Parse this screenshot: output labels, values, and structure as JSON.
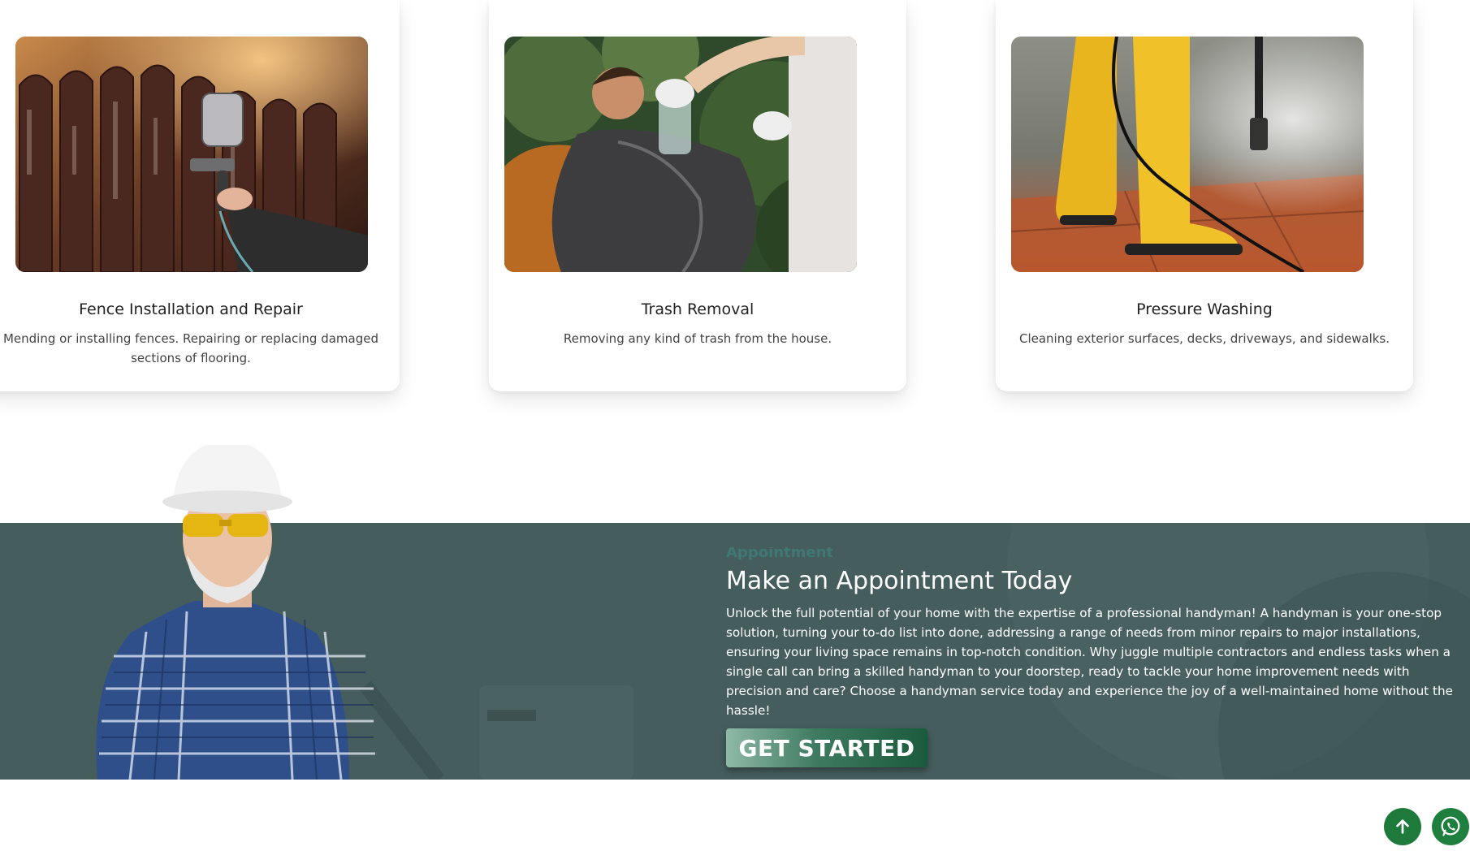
{
  "services": [
    {
      "title": "Fence Installation and Repair",
      "description": "Mending or installing fences. Repairing or replacing damaged sections of flooring.",
      "image_icon": "fence-spray-photo"
    },
    {
      "title": "Trash Removal",
      "description": "Removing any kind of trash from the house.",
      "image_icon": "trash-bag-photo"
    },
    {
      "title": "Pressure Washing",
      "description": "Cleaning exterior surfaces, decks, driveways, and sidewalks.",
      "image_icon": "pressure-washer-photo"
    }
  ],
  "appointment": {
    "eyebrow": "Appointment",
    "title": "Make an Appointment Today",
    "body": "Unlock the full potential of your home with the expertise of a professional handyman! A handyman is your one-stop solution, turning your to-do list into done, addressing a range of needs from minor repairs to major installations, ensuring your living space remains in top-notch condition. Why juggle multiple contractors and endless tasks when a single call can bring a skilled handyman to your doorstep, ready to tackle your home improvement needs with precision and care? Choose a handyman service today and experience the joy of a well-maintained home without the hassle!",
    "cta_label": "GET STARTED",
    "background_color": "#455d5d"
  },
  "floating": {
    "scroll_top_icon": "arrow-up-icon",
    "whatsapp_icon": "whatsapp-icon",
    "accent_color": "#1d7a3a"
  }
}
